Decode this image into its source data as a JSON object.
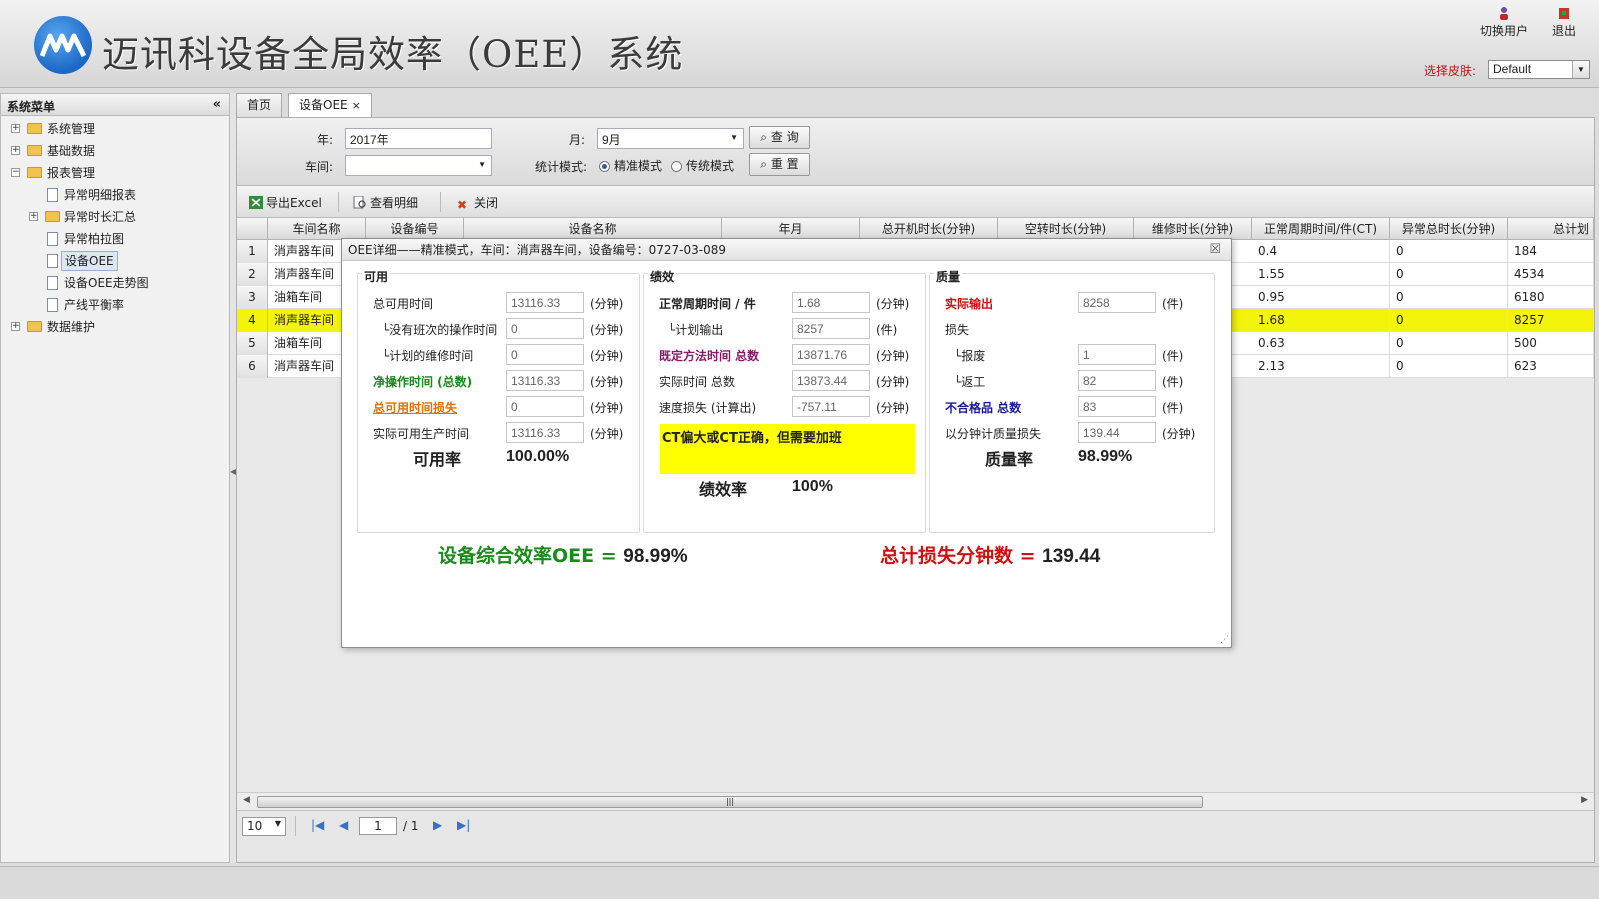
{
  "header": {
    "title": "迈讯科设备全局效率（OEE）系统",
    "switch_user": "切换用户",
    "logout": "退出",
    "skin_label": "选择皮肤:",
    "skin_value": "Default"
  },
  "sidebar": {
    "title": "系统菜单",
    "collapse": "«",
    "items": [
      {
        "label": "系统管理"
      },
      {
        "label": "基础数据"
      },
      {
        "label": "报表管理"
      },
      {
        "label": "异常明细报表"
      },
      {
        "label": "异常时长汇总"
      },
      {
        "label": "异常柏拉图"
      },
      {
        "label": "设备OEE"
      },
      {
        "label": "设备OEE走势图"
      },
      {
        "label": "产线平衡率"
      },
      {
        "label": "数据维护"
      }
    ]
  },
  "tabs": [
    {
      "label": "首页"
    },
    {
      "label": "设备OEE",
      "close": "×"
    }
  ],
  "filter": {
    "year_label": "年:",
    "year_value": "2017年",
    "month_label": "月:",
    "month_value": "9月",
    "workshop_label": "车间:",
    "workshop_value": "",
    "mode_label": "统计模式:",
    "mode_precise": "精准模式",
    "mode_traditional": "传统模式",
    "query": "查 询",
    "reset": "重 置"
  },
  "toolbar": {
    "export": "导出Excel",
    "view_detail": "查看明细",
    "close": "关闭"
  },
  "grid": {
    "columns": [
      "车间名称",
      "设备编号",
      "设备名称",
      "年月",
      "总开机时长(分钟)",
      "空转时长(分钟)",
      "维修时长(分钟)",
      "正常周期时间/件(CT)",
      "异常总时长(分钟)",
      "总计划"
    ],
    "rows": [
      {
        "num": "1",
        "workshop": "消声器车间",
        "ct": "0.4",
        "abnormal": "0",
        "plan": "184"
      },
      {
        "num": "2",
        "workshop": "消声器车间",
        "ct": "1.55",
        "abnormal": "0",
        "plan": "4534"
      },
      {
        "num": "3",
        "workshop": "油箱车间",
        "ct": "0.95",
        "abnormal": "0",
        "plan": "6180"
      },
      {
        "num": "4",
        "workshop": "消声器车间",
        "ct": "1.68",
        "abnormal": "0",
        "plan": "8257"
      },
      {
        "num": "5",
        "workshop": "油箱车间",
        "ct": "0.63",
        "abnormal": "0",
        "plan": "500"
      },
      {
        "num": "6",
        "workshop": "消声器车间",
        "ct": "2.13",
        "abnormal": "0",
        "plan": "623"
      }
    ],
    "highlight_color": "#f4f40a"
  },
  "pager": {
    "page_size": "10",
    "page": "1",
    "total": "/ 1"
  },
  "dialog": {
    "title": "OEE详细——精准模式，车间：消声器车间，设备编号：0727-03-089",
    "availability": {
      "title": "可用",
      "rows": [
        {
          "label": "总可用时间",
          "value": "13116.33",
          "unit": "(分钟)"
        },
        {
          "label": "└没有班次的操作时间",
          "value": "0",
          "unit": "(分钟)"
        },
        {
          "label": "└计划的维修时间",
          "value": "0",
          "unit": "(分钟)"
        },
        {
          "label": "净操作时间 (总数)",
          "value": "13116.33",
          "unit": "(分钟)"
        },
        {
          "label": "总可用时间损失",
          "value": "0",
          "unit": "(分钟)"
        },
        {
          "label": "实际可用生产时间",
          "value": "13116.33",
          "unit": "(分钟)"
        }
      ],
      "rate_label": "可用率",
      "rate_value": "100.00%"
    },
    "performance": {
      "title": "绩效",
      "rows": [
        {
          "label": "正常周期时间 / 件",
          "value": "1.68",
          "unit": "(分钟)"
        },
        {
          "label": "└计划输出",
          "value": "8257",
          "unit": "(件)"
        },
        {
          "label": "既定方法时间 总数",
          "value": "13871.76",
          "unit": "(分钟)"
        },
        {
          "label": "实际时间 总数",
          "value": "13873.44",
          "unit": "(分钟)"
        },
        {
          "label": "速度损失 (计算出)",
          "value": "-757.11",
          "unit": "(分钟)"
        }
      ],
      "alert": "CT偏大或CT正确，但需要加班",
      "rate_label": "绩效率",
      "rate_value": "100%"
    },
    "quality": {
      "title": "质量",
      "rows": [
        {
          "label": "实际输出",
          "value": "8258",
          "unit": "(件)"
        },
        {
          "label": "损失",
          "value": "",
          "unit": ""
        },
        {
          "label": "└报废",
          "value": "1",
          "unit": "(件)"
        },
        {
          "label": "└返工",
          "value": "82",
          "unit": "(件)"
        },
        {
          "label": "不合格品 总数",
          "value": "83",
          "unit": "(件)"
        },
        {
          "label": "以分钟计质量损失",
          "value": "139.44",
          "unit": "(分钟)"
        }
      ],
      "rate_label": "质量率",
      "rate_value": "98.99%"
    },
    "oee_label": "设备综合效率OEE = ",
    "oee_value": "98.99%",
    "loss_label": "总计损失分钟数 = ",
    "loss_value": "139.44"
  },
  "colors": {
    "accent_red": "#c0141b",
    "green": "#1a8a1a",
    "orange": "#e07000",
    "purple": "#8b1a6b",
    "blue": "#1a1aa0",
    "highlight_yellow": "#ffff00"
  }
}
